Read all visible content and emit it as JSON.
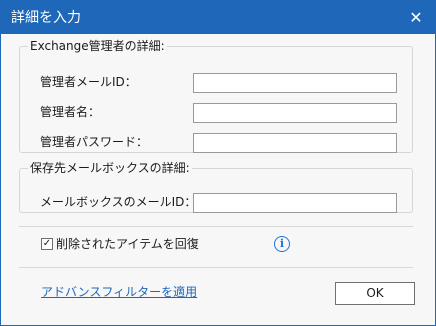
{
  "dialog": {
    "title": "詳細を入力",
    "close_glyph": "✕"
  },
  "exchange_group": {
    "legend": "Exchange管理者の詳細:",
    "fields": [
      {
        "label": "管理者メールID：",
        "value": ""
      },
      {
        "label": "管理者名：",
        "value": ""
      },
      {
        "label": "管理者パスワード：",
        "value": ""
      }
    ]
  },
  "destination_group": {
    "legend": "保存先メールボックスの詳細:",
    "fields": [
      {
        "label": "メールボックスのメールID：",
        "value": ""
      }
    ]
  },
  "options": {
    "recover_deleted_label": "削除されたアイテムを回復",
    "recover_deleted_checked": true,
    "checkmark": "✓",
    "info_glyph": "i"
  },
  "footer": {
    "advanced_filter_link": "アドバンスフィルターを適用",
    "ok_label": "OK"
  },
  "colors": {
    "titlebar": "#1f67b8",
    "info": "#1f73d6"
  }
}
